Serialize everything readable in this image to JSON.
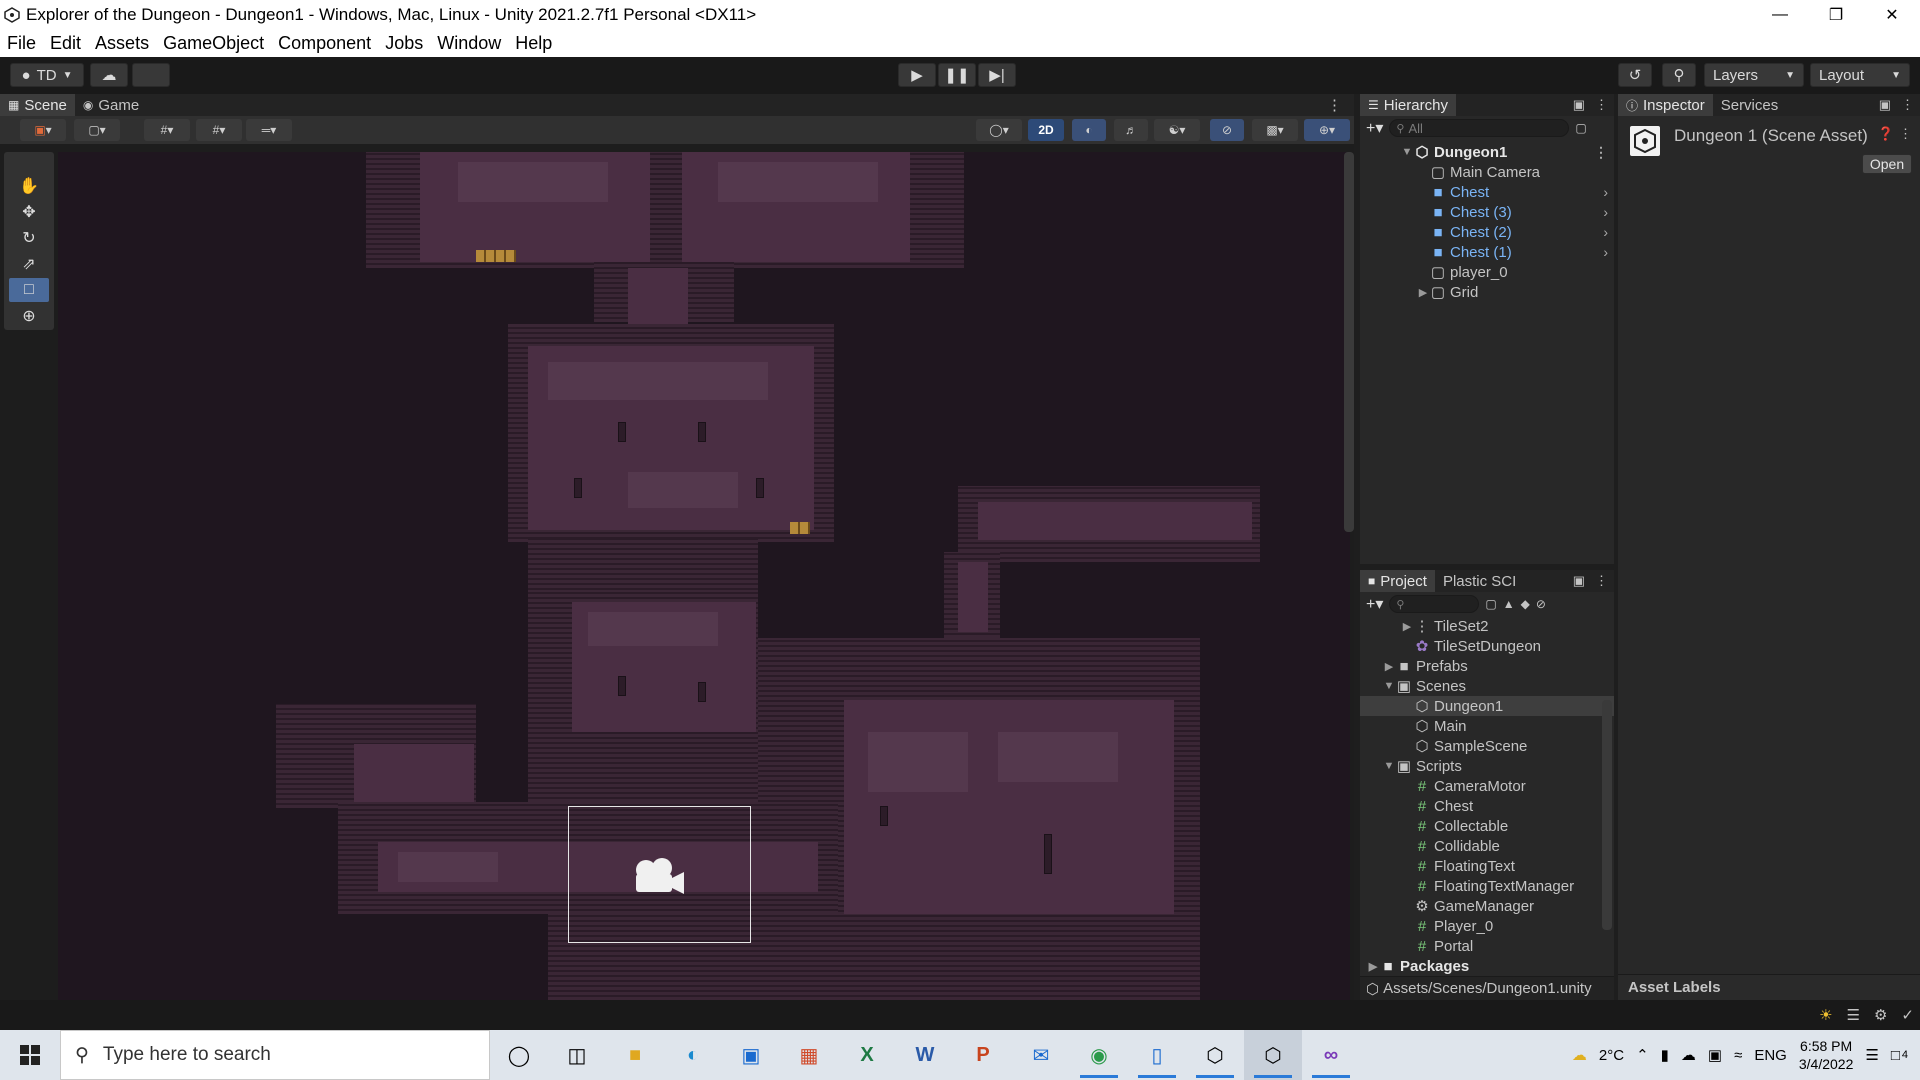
{
  "window": {
    "title": "Explorer of the Dungeon - Dungeon1 - Windows, Mac, Linux - Unity 2021.2.7f1 Personal <DX11>",
    "buttons": [
      "minimize",
      "restore",
      "close"
    ]
  },
  "menubar": [
    "File",
    "Edit",
    "Assets",
    "GameObject",
    "Component",
    "Jobs",
    "Window",
    "Help"
  ],
  "toolbar": {
    "account_label": "TD",
    "layers_label": "Layers",
    "layout_label": "Layout"
  },
  "scene": {
    "tabs": [
      "Scene",
      "Game"
    ],
    "mode_2d_label": "2D"
  },
  "hierarchy": {
    "tab_label": "Hierarchy",
    "search_placeholder": "All",
    "items": [
      {
        "label": "Dungeon1",
        "depth": 0,
        "expanded": true,
        "kind": "scene"
      },
      {
        "label": "Main Camera",
        "depth": 1,
        "kind": "object"
      },
      {
        "label": "Chest",
        "depth": 1,
        "kind": "prefab"
      },
      {
        "label": "Chest (3)",
        "depth": 1,
        "kind": "prefab"
      },
      {
        "label": "Chest (2)",
        "depth": 1,
        "kind": "prefab"
      },
      {
        "label": "Chest (1)",
        "depth": 1,
        "kind": "prefab"
      },
      {
        "label": "player_0",
        "depth": 1,
        "kind": "object"
      },
      {
        "label": "Grid",
        "depth": 1,
        "kind": "object",
        "collapsed": true
      }
    ]
  },
  "inspector": {
    "tabs": [
      "Inspector",
      "Services"
    ],
    "asset_title": "Dungeon 1 (Scene Asset)",
    "open_label": "Open",
    "asset_labels": "Asset Labels"
  },
  "project": {
    "tabs": [
      "Project",
      "Plastic SCI"
    ],
    "items": [
      {
        "label": "TileSet2",
        "depth": 2,
        "kind": "tileset",
        "collapsed": true
      },
      {
        "label": "TileSetDungeon",
        "depth": 2,
        "kind": "tilepalette"
      },
      {
        "label": "Prefabs",
        "depth": 1,
        "kind": "folder",
        "collapsed": true
      },
      {
        "label": "Scenes",
        "depth": 1,
        "kind": "folder-open",
        "expanded": true
      },
      {
        "label": "Dungeon1",
        "depth": 2,
        "kind": "scene",
        "selected": true
      },
      {
        "label": "Main",
        "depth": 2,
        "kind": "scene"
      },
      {
        "label": "SampleScene",
        "depth": 2,
        "kind": "scene"
      },
      {
        "label": "Scripts",
        "depth": 1,
        "kind": "folder-open",
        "expanded": true
      },
      {
        "label": "CameraMotor",
        "depth": 2,
        "kind": "script"
      },
      {
        "label": "Chest",
        "depth": 2,
        "kind": "script"
      },
      {
        "label": "Collectable",
        "depth": 2,
        "kind": "script"
      },
      {
        "label": "Collidable",
        "depth": 2,
        "kind": "script"
      },
      {
        "label": "FloatingText",
        "depth": 2,
        "kind": "script"
      },
      {
        "label": "FloatingTextManager",
        "depth": 2,
        "kind": "script"
      },
      {
        "label": "GameManager",
        "depth": 2,
        "kind": "gear"
      },
      {
        "label": "Player_0",
        "depth": 2,
        "kind": "script"
      },
      {
        "label": "Portal",
        "depth": 2,
        "kind": "script"
      },
      {
        "label": "Packages",
        "depth": 0,
        "kind": "folder",
        "collapsed": true,
        "bold": true
      }
    ],
    "path": "Assets/Scenes/Dungeon1.unity"
  },
  "taskbar": {
    "search_placeholder": "Type here to search",
    "temperature": "2°C",
    "language": "ENG",
    "time": "6:58 PM",
    "date": "3/4/2022",
    "notifications": "4"
  },
  "colors": {
    "prefab_blue": "#7ab4f5",
    "dungeon_floor": "#4a2e43",
    "accent_blue": "#2d4a78"
  }
}
